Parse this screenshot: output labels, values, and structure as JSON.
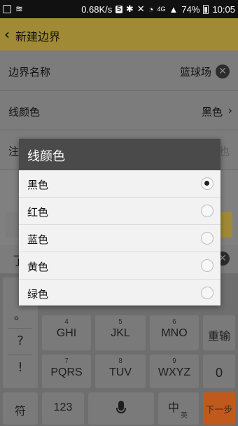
{
  "status_bar": {
    "speed": "0.68K/s",
    "five_g_badge": "5",
    "network": "4G",
    "battery": "74%",
    "time": "10:05"
  },
  "header": {
    "title": "新建边界"
  },
  "form": {
    "name_label": "边界名称",
    "name_value": "篮球场",
    "line_color_label": "线颜色",
    "line_color_value": "黑色",
    "note_label": "注",
    "note_partial_right": "也",
    "input_partial": "了"
  },
  "dialog": {
    "title": "线颜色",
    "options": [
      {
        "label": "黑色",
        "checked": true
      },
      {
        "label": "红色",
        "checked": false
      },
      {
        "label": "蓝色",
        "checked": false
      },
      {
        "label": "黄色",
        "checked": false
      },
      {
        "label": "绿色",
        "checked": false
      }
    ]
  },
  "keyboard": {
    "symbols": [
      "。",
      "?",
      "!"
    ],
    "row2": [
      {
        "num": "4",
        "letters": "GHI"
      },
      {
        "num": "5",
        "letters": "JKL"
      },
      {
        "num": "6",
        "letters": "MNO"
      }
    ],
    "row3": [
      {
        "num": "7",
        "letters": "PQRS"
      },
      {
        "num": "8",
        "letters": "TUV"
      },
      {
        "num": "9",
        "letters": "WXYZ"
      }
    ],
    "reenter": "重输",
    "zero": "0",
    "sym_key": "符",
    "num_key": "123",
    "lang_key": "中",
    "lang_sub": "英",
    "next_key": "下一步"
  }
}
